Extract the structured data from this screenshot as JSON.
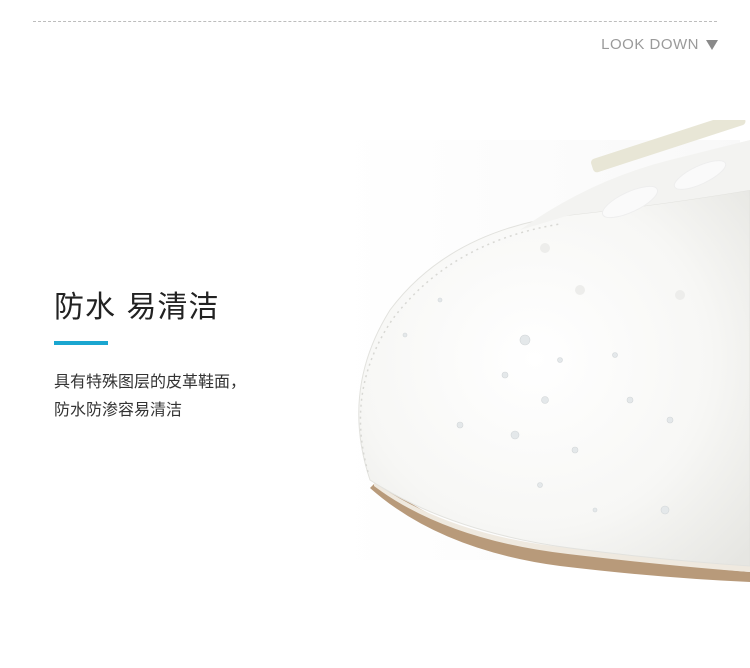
{
  "header": {
    "look_down_label": "LOOK DOWN"
  },
  "feature": {
    "title": "防水 易清洁",
    "description_lines": [
      "具有特殊图层的皮革鞋面，",
      "防水防渗容易清洁"
    ]
  },
  "colors": {
    "accent": "#1aa6d0",
    "text": "#222222",
    "muted": "#9a9a9a"
  },
  "image": {
    "subject": "white-leather-shoe-toe-with-water-droplets"
  }
}
